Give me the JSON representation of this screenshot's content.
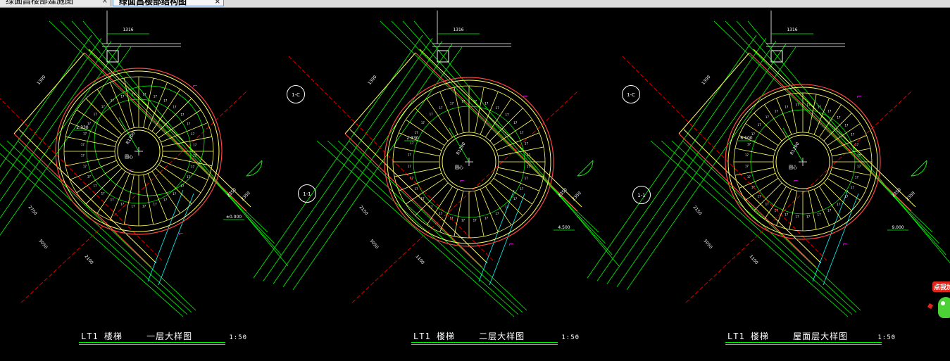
{
  "tabs": [
    {
      "label": "绿面昌楼部建施图",
      "close": "×"
    },
    {
      "label": "绿面昌楼部结构图",
      "close": "×"
    }
  ],
  "axis_bubbles": [
    "1-C",
    "1-1",
    "1-C",
    "1-1"
  ],
  "panels": [
    {
      "title_prefix": "LT1 楼梯",
      "title_name": "一层大样图",
      "scale": "1:50",
      "dims": {
        "top": "1316",
        "mid_left": "1300",
        "diag1": "2750",
        "diag2": "5050",
        "diag3": "2100",
        "right1": "2350",
        "right2": "2350",
        "radius": "R1200",
        "elev": "±0.000",
        "elev2": "2.330",
        "center": "圆心"
      }
    },
    {
      "title_prefix": "LT1 楼梯",
      "title_name": "二层大样图",
      "scale": "1:50",
      "dims": {
        "top": "1316",
        "mid_left": "1300",
        "diag1": "2150",
        "diag2": "5050",
        "diag3": "1100",
        "right1": "2350",
        "right2": "2350",
        "radius": "R1200",
        "elev": "4.500",
        "elev2": "2.330",
        "center": "圆心"
      }
    },
    {
      "title_prefix": "LT1 楼梯",
      "title_name": "屋面层大样图",
      "scale": "1:50",
      "dims": {
        "top": "1316",
        "mid_left": "1300",
        "diag1": "2150",
        "diag2": "5050",
        "diag3": "1100",
        "right1": "2350",
        "right2": "2350",
        "radius": "R1200",
        "elev": "9.000",
        "elev2": "6.500",
        "center": "圆心"
      }
    }
  ],
  "widget": {
    "label": "点我加"
  },
  "colors": {
    "background": "#000000",
    "dimension": "#00ff00",
    "stair": "#ffff66",
    "wall": "#ff4444",
    "axis": "#ff0000",
    "annotation": "#ff00ff",
    "extra": "#00ffff",
    "text": "#ffffff"
  }
}
